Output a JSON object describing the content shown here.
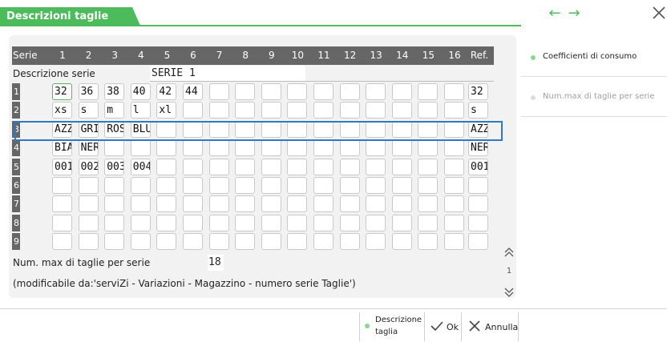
{
  "window": {
    "title": "Descrizioni taglie",
    "accent_color": "#4cbb5c",
    "highlight_color": "#2f78c4",
    "nav_prev_icon": "arrow-left-icon",
    "nav_next_icon": "arrow-right-icon",
    "close_icon": "close-icon"
  },
  "grid": {
    "header_label": "Serie",
    "columns": [
      "1",
      "2",
      "3",
      "4",
      "5",
      "6",
      "7",
      "8",
      "9",
      "10",
      "11",
      "12",
      "13",
      "14",
      "15",
      "16"
    ],
    "ref_label": "Ref.",
    "description_label": "Descrizione serie",
    "description_value": "SERIE 1",
    "rows": [
      {
        "num": "1",
        "cells": [
          "32",
          "36",
          "38",
          "40",
          "42",
          "44",
          "",
          "",
          "",
          "",
          "",
          "",
          "",
          "",
          "",
          ""
        ],
        "ref": "32"
      },
      {
        "num": "2",
        "cells": [
          "xs",
          "s",
          "m",
          "l",
          "xl",
          "",
          "",
          "",
          "",
          "",
          "",
          "",
          "",
          "",
          "",
          ""
        ],
        "ref": "s"
      },
      {
        "num": "3",
        "cells": [
          "AZZ",
          "GRI",
          "ROS",
          "BLU",
          "",
          "",
          "",
          "",
          "",
          "",
          "",
          "",
          "",
          "",
          "",
          ""
        ],
        "ref": "AZZ"
      },
      {
        "num": "4",
        "cells": [
          "BIA",
          "NER",
          "",
          "",
          "",
          "",
          "",
          "",
          "",
          "",
          "",
          "",
          "",
          "",
          "",
          ""
        ],
        "ref": "NER"
      },
      {
        "num": "5",
        "cells": [
          "001",
          "002",
          "003",
          "004",
          "",
          "",
          "",
          "",
          "",
          "",
          "",
          "",
          "",
          "",
          "",
          ""
        ],
        "ref": "001"
      },
      {
        "num": "6",
        "cells": [
          "",
          "",
          "",
          "",
          "",
          "",
          "",
          "",
          "",
          "",
          "",
          "",
          "",
          "",
          "",
          ""
        ],
        "ref": ""
      },
      {
        "num": "7",
        "cells": [
          "",
          "",
          "",
          "",
          "",
          "",
          "",
          "",
          "",
          "",
          "",
          "",
          "",
          "",
          "",
          ""
        ],
        "ref": ""
      },
      {
        "num": "8",
        "cells": [
          "",
          "",
          "",
          "",
          "",
          "",
          "",
          "",
          "",
          "",
          "",
          "",
          "",
          "",
          "",
          ""
        ],
        "ref": ""
      },
      {
        "num": "9",
        "cells": [
          "",
          "",
          "",
          "",
          "",
          "",
          "",
          "",
          "",
          "",
          "",
          "",
          "",
          "",
          "",
          ""
        ],
        "ref": ""
      }
    ]
  },
  "footer": {
    "nummax_label": "Num. max di taglie per serie",
    "nummax_value": "18",
    "note": "(modificabile da:'serviZi - Variazioni - Magazzino - numero serie Taglie')"
  },
  "scroll": {
    "page": "1",
    "up_icon": "double-chevron-up-icon",
    "down_icon": "double-chevron-down-icon"
  },
  "sidebar": {
    "items": [
      {
        "label": "Coefficienti di consumo",
        "enabled": true
      },
      {
        "label": "Num.max di taglie per serie",
        "enabled": false
      }
    ]
  },
  "bottom": {
    "descrizione_line1": "Descrizione",
    "descrizione_line2": "taglia",
    "ok_label": "Ok",
    "annulla_label": "Annulla"
  }
}
